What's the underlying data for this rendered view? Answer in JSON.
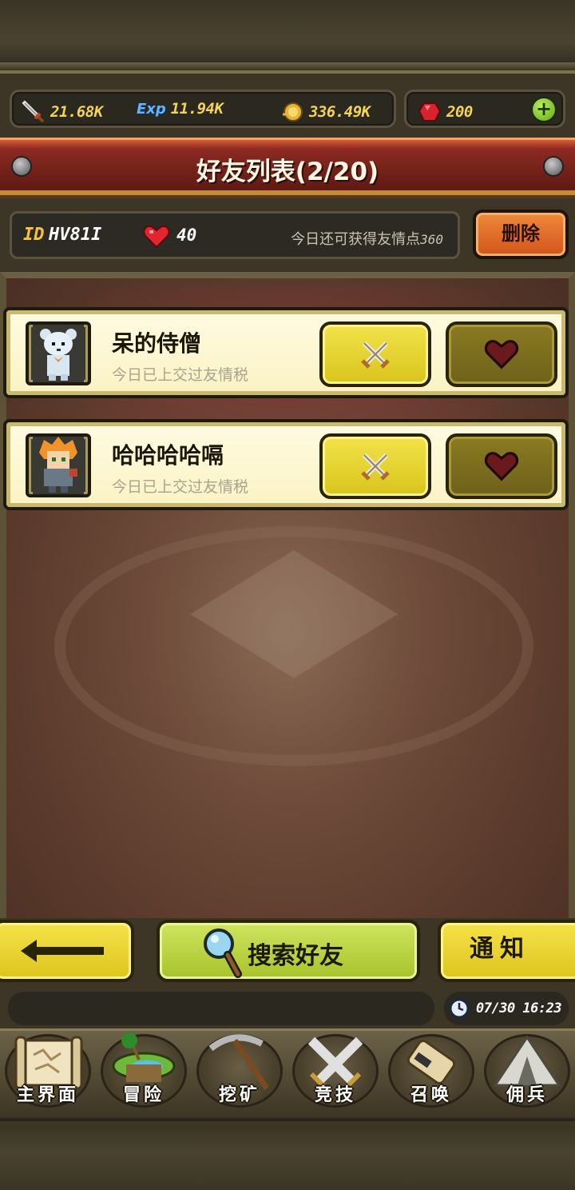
{
  "resources": {
    "attack": "21.68K",
    "exp_label": "Exp",
    "exp": "11.94K",
    "gold": "336.49K",
    "gems": "200"
  },
  "title": "好友列表(2/20)",
  "player": {
    "id_label": "ID",
    "id": "HV81I",
    "hearts": "40",
    "today_label": "今日还可获得友情点",
    "today_value": "360"
  },
  "delete_label": "删除",
  "friends": [
    {
      "name": "呆的侍僧",
      "status": "今日已上交过友情税"
    },
    {
      "name": "哈哈哈哈嗝",
      "status": "今日已上交过友情税"
    }
  ],
  "search_label": "搜索好友",
  "notify_label": "通知",
  "time": "07/30 16:23",
  "nav": [
    {
      "label": "主界面",
      "icon": "scroll-map-icon"
    },
    {
      "label": "冒险",
      "icon": "island-icon"
    },
    {
      "label": "挖矿",
      "icon": "pickaxe-icon"
    },
    {
      "label": "竞技",
      "icon": "crossed-swords-icon"
    },
    {
      "label": "召唤",
      "icon": "summon-scroll-icon"
    },
    {
      "label": "佣兵",
      "icon": "tent-icon"
    }
  ],
  "colors": {
    "accent_yellow": "#f3d35a",
    "banner_red": "#742219",
    "button_yellow": "#ddc51d",
    "button_green": "#a8c32c",
    "delete_orange": "#d2541b"
  }
}
